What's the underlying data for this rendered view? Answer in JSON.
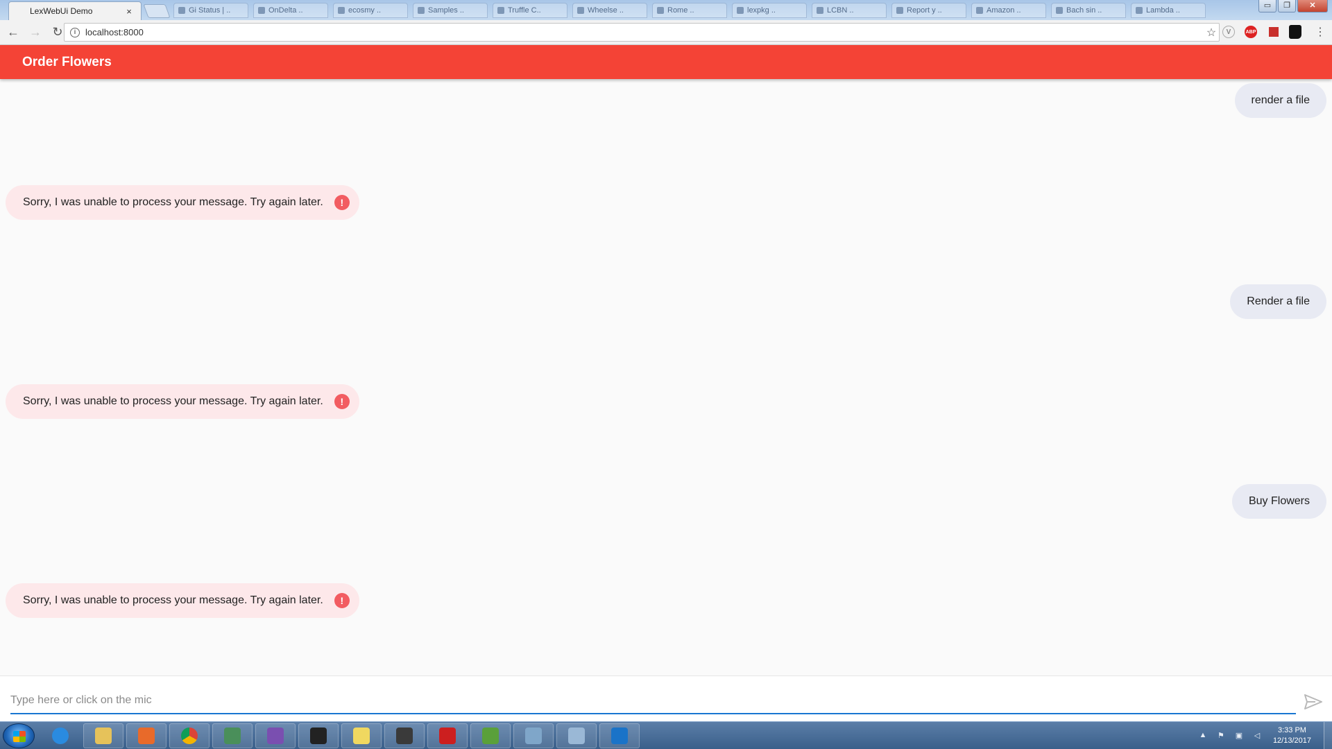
{
  "browser": {
    "active_tab": {
      "title": "LexWebUi Demo",
      "close": "×"
    },
    "background_tabs": [
      "Gi Status | ..",
      "OnDelta ..",
      "ecosmy ..",
      "Samples ..",
      "Truffle C..",
      "Wheelse ..",
      "Rome ..",
      "lexpkg ..",
      "LCBN ..",
      "Report y ..",
      "Amazon ..",
      "Bach sin ..",
      "Lambda .."
    ],
    "window_controls": {
      "minimize": "▭",
      "restore": "❐",
      "close": "✕"
    },
    "nav": {
      "back": "←",
      "forward": "→",
      "reload": "↻"
    },
    "address": {
      "info_icon": "i",
      "url": "localhost:8000",
      "bookmark_icon": "☆"
    },
    "extensions": {
      "v_label": "V",
      "abp_label": "ABP",
      "menu": "⋮"
    }
  },
  "app": {
    "title": "Order Flowers",
    "colors": {
      "header": "#f44336",
      "human_bubble": "#e8eaf3",
      "bot_bubble": "#fde8ea",
      "error_icon": "#f25c61",
      "input_underline": "#1976d2"
    }
  },
  "messages": [
    {
      "type": "human",
      "text": "render a file"
    },
    {
      "type": "bot",
      "text": "Sorry, I was unable to process your message. Try again later.",
      "icon": "!"
    },
    {
      "type": "human",
      "text": "Render a file"
    },
    {
      "type": "bot",
      "text": "Sorry, I was unable to process your message. Try again later.",
      "icon": "!"
    },
    {
      "type": "human",
      "text": "Buy Flowers"
    },
    {
      "type": "bot",
      "text": "Sorry, I was unable to process your message. Try again later.",
      "icon": "!"
    }
  ],
  "input": {
    "value": "",
    "placeholder": "Type here or click on the mic"
  },
  "taskbar": {
    "apps": [
      "internet-explorer-icon",
      "file-explorer-icon",
      "media-player-icon",
      "chrome-icon",
      "app-window-icon",
      "visual-studio-icon",
      "command-prompt-icon",
      "sticky-notes-icon",
      "wordpress-icon",
      "acrobat-icon",
      "task-manager-icon",
      "calculator-icon",
      "document-icon",
      "teamviewer-icon"
    ],
    "clock": {
      "time": "3:33 PM",
      "date": "12/13/2017"
    },
    "tray_expand": "▲"
  }
}
